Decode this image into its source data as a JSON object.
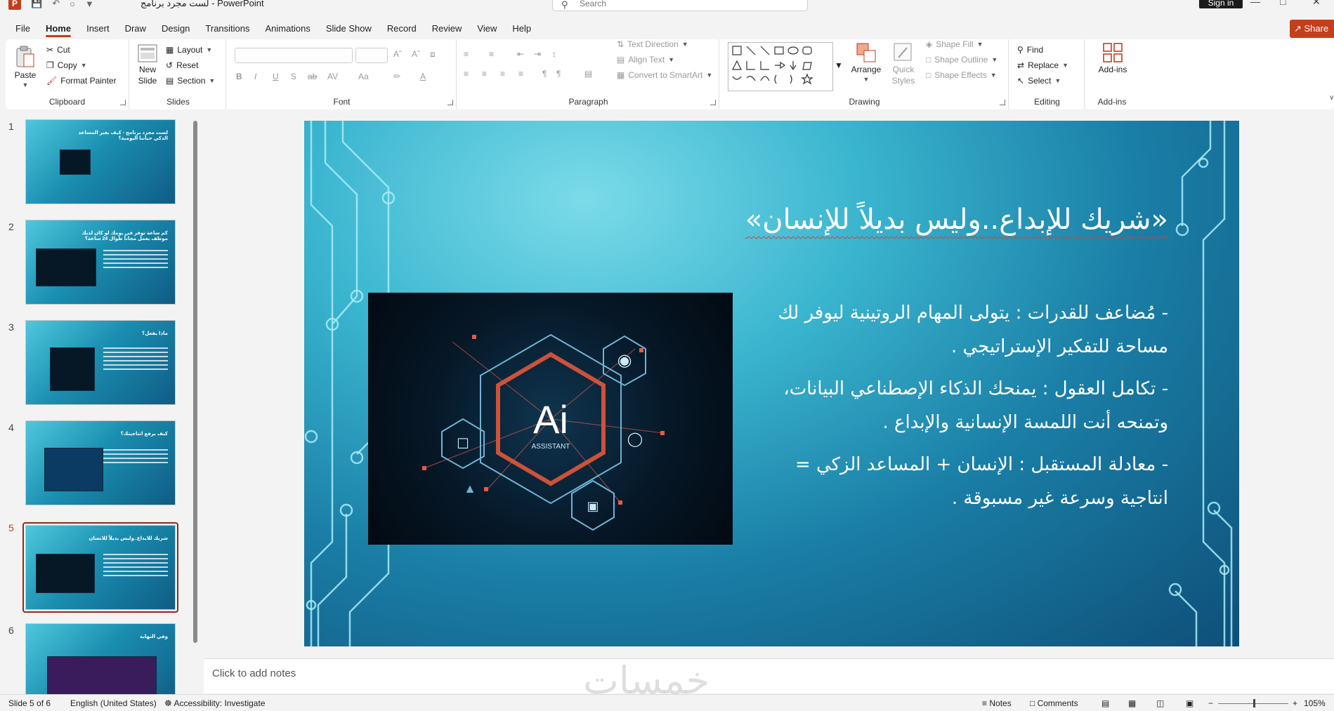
{
  "app": {
    "document_title": "لست مجرد برنامج",
    "app_name": "PowerPoint",
    "title_separator": " - ",
    "search_placeholder": "Search",
    "sign_in": "Sign in",
    "share": "Share"
  },
  "tabs": [
    "File",
    "Home",
    "Insert",
    "Draw",
    "Design",
    "Transitions",
    "Animations",
    "Slide Show",
    "Record",
    "Review",
    "View",
    "Help"
  ],
  "active_tab": "Home",
  "ribbon": {
    "clipboard": {
      "label": "Clipboard",
      "paste": "Paste",
      "cut": "Cut",
      "copy": "Copy",
      "format_painter": "Format Painter"
    },
    "slides": {
      "label": "Slides",
      "new_slide_1": "New",
      "new_slide_2": "Slide",
      "layout": "Layout",
      "reset": "Reset",
      "section": "Section"
    },
    "font": {
      "label": "Font"
    },
    "paragraph": {
      "label": "Paragraph",
      "text_direction": "Text Direction",
      "align_text": "Align Text",
      "convert_smartart": "Convert to SmartArt"
    },
    "drawing": {
      "label": "Drawing",
      "arrange": "Arrange",
      "quick_styles_1": "Quick",
      "quick_styles_2": "Styles",
      "shape_fill": "Shape Fill",
      "shape_outline": "Shape Outline",
      "shape_effects": "Shape Effects"
    },
    "editing": {
      "label": "Editing",
      "find": "Find",
      "replace": "Replace",
      "select": "Select"
    },
    "addins": {
      "label": "Add-ins",
      "button": "Add-ins"
    }
  },
  "thumbnails": [
    {
      "num": "1",
      "title": "لست مجرد برنامج - كيف يغير المساعد الذكي حياتنا اليومية؟"
    },
    {
      "num": "2",
      "title": "كم ساعة توفر في يومك لو كان لديك موظف يعمل مجاناً طوال 24 ساعة؟"
    },
    {
      "num": "3",
      "title": "ماذا يفعل؟"
    },
    {
      "num": "4",
      "title": "كيف يرفع انتاجيتك؟"
    },
    {
      "num": "5",
      "title": "شريك للابداع..وليس بديلاً للانسان"
    },
    {
      "num": "6",
      "title": "وفي النهاية"
    }
  ],
  "active_slide": 5,
  "slide": {
    "title": "«شريك للإبداع..وليس بديلاً للإنسان»",
    "bullets": [
      "- مُضاعف للقدرات : يتولى المهام الروتينية ليوفر لك مساحة للتفكير الإستراتيجي .",
      "- تكامل العقول : يمنحك الذكاء الإصطناعي البيانات، وتمنحه أنت اللمسة الإنسانية والإبداع .",
      "- معادلة المستقبل : الإنسان + المساعد الزكي = انتاجية وسرعة غير مسبوقة ."
    ],
    "image": {
      "main_text": "Ai",
      "sub_text": "ASSISTANT"
    }
  },
  "notes_placeholder": "Click to add notes",
  "watermark": "خمسات",
  "status": {
    "slide_of": "Slide 5 of 6",
    "language": "English (United States)",
    "accessibility": "Accessibility: Investigate",
    "notes": "Notes",
    "comments": "Comments",
    "zoom": "105%",
    "zoom_minus": "−",
    "zoom_plus": "+"
  },
  "colors": {
    "accent": "#c43e1c",
    "slide_dark": "#0e4f78",
    "slide_light": "#3ab5cf"
  },
  "icons": [
    "powerpoint-logo",
    "save-icon",
    "undo-icon",
    "search-icon",
    "paste-icon",
    "cut-icon",
    "copy-icon",
    "format-painter-icon",
    "find-icon",
    "replace-icon",
    "select-icon",
    "addins-icon",
    "notes-icon",
    "comments-icon"
  ]
}
